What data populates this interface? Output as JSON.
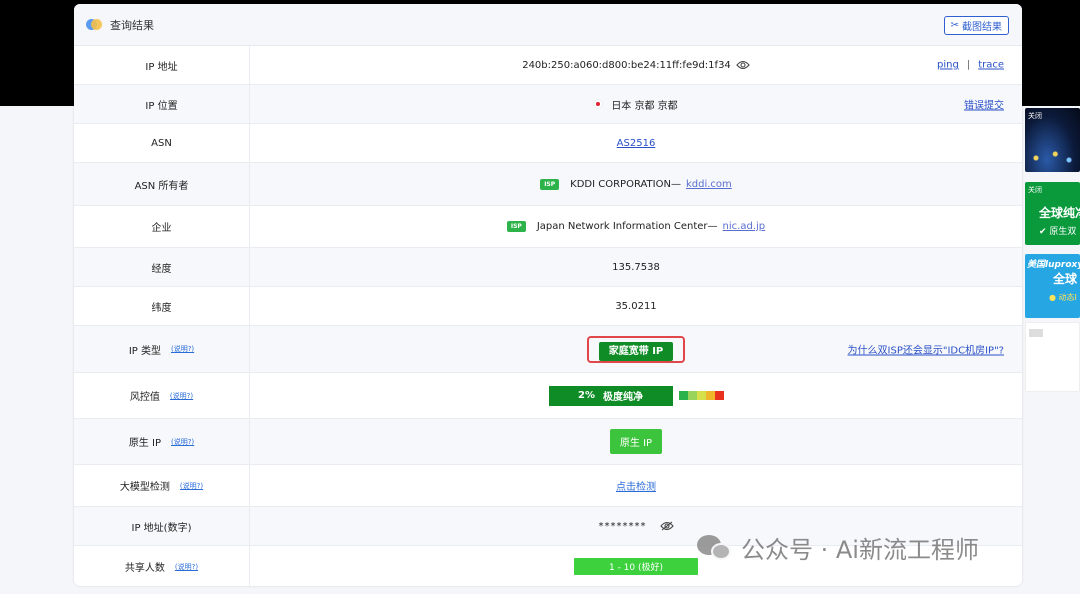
{
  "header": {
    "title": "查询结果",
    "screenshot_label": "截图结果"
  },
  "rows": {
    "ip_address": {
      "label": "IP 地址",
      "value": "240b:250:a060:d800:be24:11ff:fe9d:1f34",
      "ping": "ping",
      "separator": "|",
      "trace": "trace"
    },
    "ip_location": {
      "label": "IP 位置",
      "value": "日本 京都 京都",
      "report_link": "错误提交"
    },
    "asn": {
      "label": "ASN",
      "value": "AS2516"
    },
    "asn_owner": {
      "label": "ASN 所有者",
      "badge": "ISP",
      "name": "KDDI CORPORATION—",
      "domain": "kddi.com"
    },
    "enterprise": {
      "label": "企业",
      "badge": "ISP",
      "name": "Japan Network Information Center—",
      "domain": "nic.ad.jp"
    },
    "longitude": {
      "label": "经度",
      "value": "135.7538"
    },
    "latitude": {
      "label": "纬度",
      "value": "35.0211"
    },
    "ip_type": {
      "label": "IP 类型",
      "explain": "(说明?)",
      "value": "家庭宽带 IP",
      "why_link": "为什么双ISP还会显示\"IDC机房IP\"?"
    },
    "risk": {
      "label": "风控值",
      "explain": "(说明?)",
      "percent": "2%",
      "level": "极度纯净",
      "scale_colors": [
        "#2bb24c",
        "#9bd45a",
        "#d6e04a",
        "#f0b62a",
        "#e8321e"
      ]
    },
    "native_ip": {
      "label": "原生 IP",
      "explain": "(说明?)",
      "value": "原生 IP"
    },
    "llm_check": {
      "label": "大模型检测",
      "explain": "(说明?)",
      "value": "点击检测"
    },
    "ip_numeric": {
      "label": "IP 地址(数字)",
      "value": "********"
    },
    "shared_users": {
      "label": "共享人数",
      "explain": "(说明?)",
      "value": "1 - 10 (极好)"
    }
  },
  "ads": {
    "close_label": "关闭",
    "ad2_title": "全球纯净",
    "ad2_sub": "原生双",
    "ad3_brand": "美国luproxy",
    "ad3_title": "全球",
    "ad3_sub": "● 动态I"
  },
  "watermark": {
    "text": "公众号 · Ai新流工程师"
  },
  "colors": {
    "accent": "#2a50c7",
    "pure_green": "#0f8c26",
    "highlight_red": "#e0464a"
  }
}
